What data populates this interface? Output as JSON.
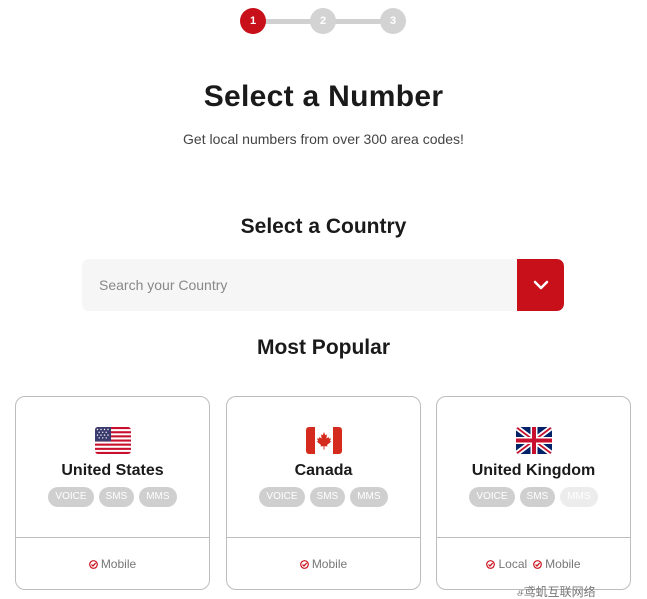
{
  "stepper": {
    "steps": [
      "1",
      "2",
      "3"
    ]
  },
  "header": {
    "title": "Select a Number",
    "subtitle": "Get local numbers from over 300 area codes!"
  },
  "country": {
    "heading": "Select a Country",
    "search_placeholder": "Search your Country"
  },
  "popular": {
    "heading": "Most Popular",
    "cards": [
      {
        "name": "United States",
        "badges": [
          "VOICE",
          "SMS",
          "MMS"
        ],
        "features": [
          "Mobile"
        ]
      },
      {
        "name": "Canada",
        "badges": [
          "VOICE",
          "SMS",
          "MMS"
        ],
        "features": [
          "Mobile"
        ]
      },
      {
        "name": "United Kingdom",
        "badges": [
          "VOICE",
          "SMS",
          "MMS"
        ],
        "features": [
          "Local",
          "Mobile"
        ]
      }
    ]
  },
  "watermark": "ச鸢虮互联网络",
  "colors": {
    "accent": "#c8101a",
    "badge": "#cfcfcf",
    "badge_disabled": "#ececec"
  }
}
